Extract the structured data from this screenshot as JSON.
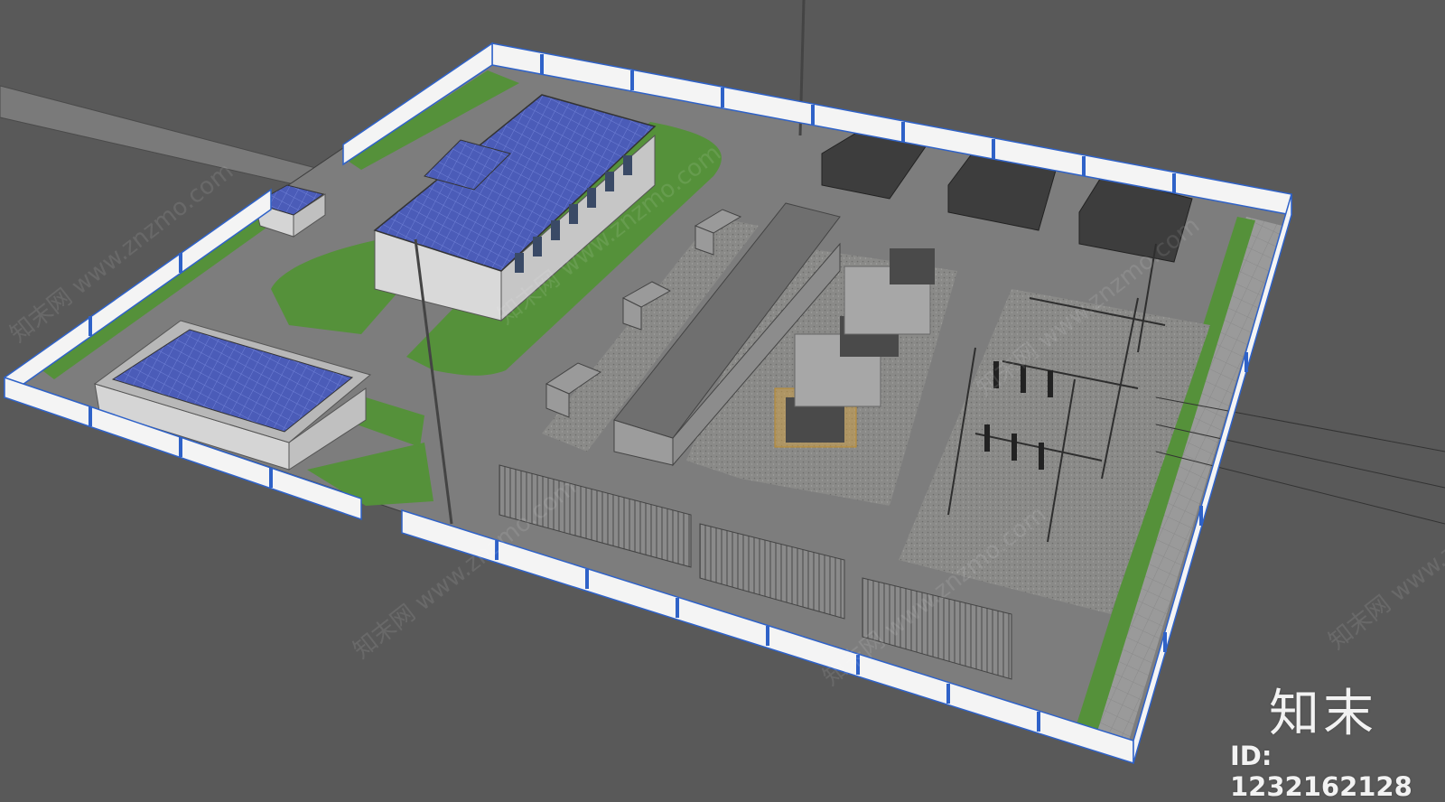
{
  "scene": {
    "kind": "3d-render",
    "subject": "substation site model",
    "colors": {
      "background": "#595959",
      "ground": "#7d7d7d",
      "lawn": "#55913a",
      "roof": "#4b5cb8",
      "wall_panel": "#f4f4f4",
      "wall_post": "#2f62c8",
      "gravel": "#8a8a88",
      "container": "#8c8c8c"
    }
  },
  "watermark": {
    "logo_text": "知末",
    "id_text": "ID: 1232162128",
    "repeat_text": "知末网 www.znzmo.com"
  }
}
